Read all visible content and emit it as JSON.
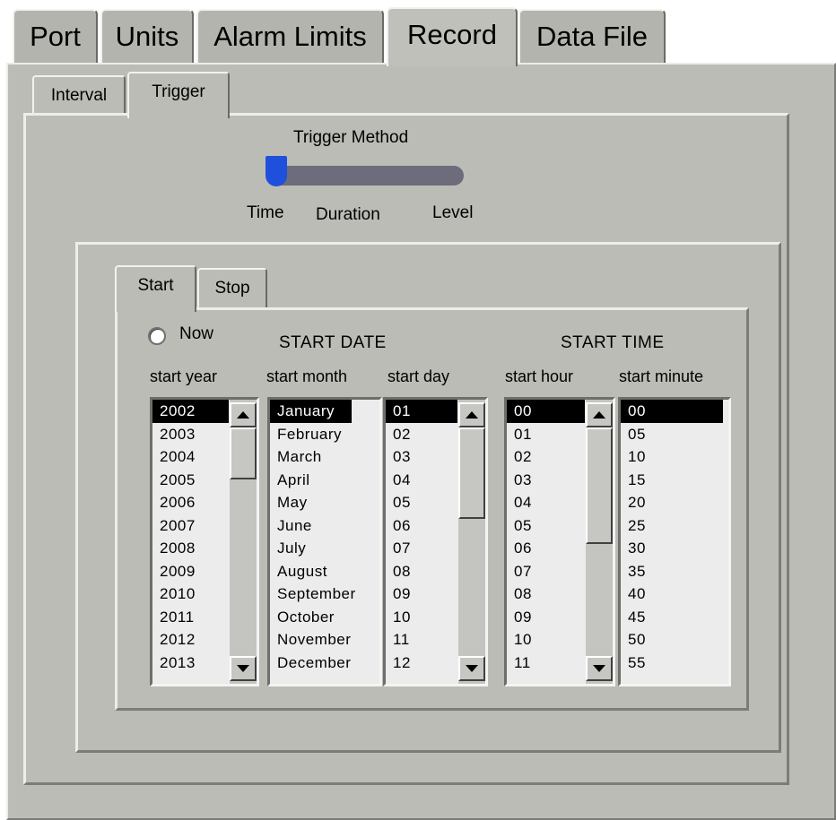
{
  "tabs": [
    {
      "label": "Port",
      "active": false
    },
    {
      "label": "Units",
      "active": false
    },
    {
      "label": "Alarm Limits",
      "active": false
    },
    {
      "label": "Record",
      "active": true
    },
    {
      "label": "Data File",
      "active": false
    }
  ],
  "subtabs": [
    {
      "label": "Interval",
      "active": false
    },
    {
      "label": "Trigger",
      "active": true
    }
  ],
  "trigger": {
    "title": "Trigger Method",
    "options": [
      "Time",
      "Duration",
      "Level"
    ],
    "selected": "Time",
    "slider_color": "#1e50dc"
  },
  "startstop_tabs": [
    {
      "label": "Start",
      "active": true
    },
    {
      "label": "Stop",
      "active": false
    }
  ],
  "start": {
    "now_label": "Now",
    "now_checked": false,
    "date_header": "START DATE",
    "time_header": "START TIME",
    "columns": {
      "year": "start year",
      "month": "start month",
      "day": "start day",
      "hour": "start hour",
      "minute": "start minute"
    },
    "years": [
      "2002",
      "2003",
      "2004",
      "2005",
      "2006",
      "2007",
      "2008",
      "2009",
      "2010",
      "2011",
      "2012",
      "2013"
    ],
    "months": [
      "January",
      "February",
      "March",
      "April",
      "May",
      "June",
      "July",
      "August",
      "September",
      "October",
      "November",
      "December"
    ],
    "days": [
      "01",
      "02",
      "03",
      "04",
      "05",
      "06",
      "07",
      "08",
      "09",
      "10",
      "11",
      "12"
    ],
    "hours": [
      "00",
      "01",
      "02",
      "03",
      "04",
      "05",
      "06",
      "07",
      "08",
      "09",
      "10",
      "11"
    ],
    "minutes": [
      "00",
      "05",
      "10",
      "15",
      "20",
      "25",
      "30",
      "35",
      "40",
      "45",
      "50",
      "55"
    ],
    "selected": {
      "year": "2002",
      "month": "January",
      "day": "01",
      "hour": "00",
      "minute": "00"
    }
  }
}
